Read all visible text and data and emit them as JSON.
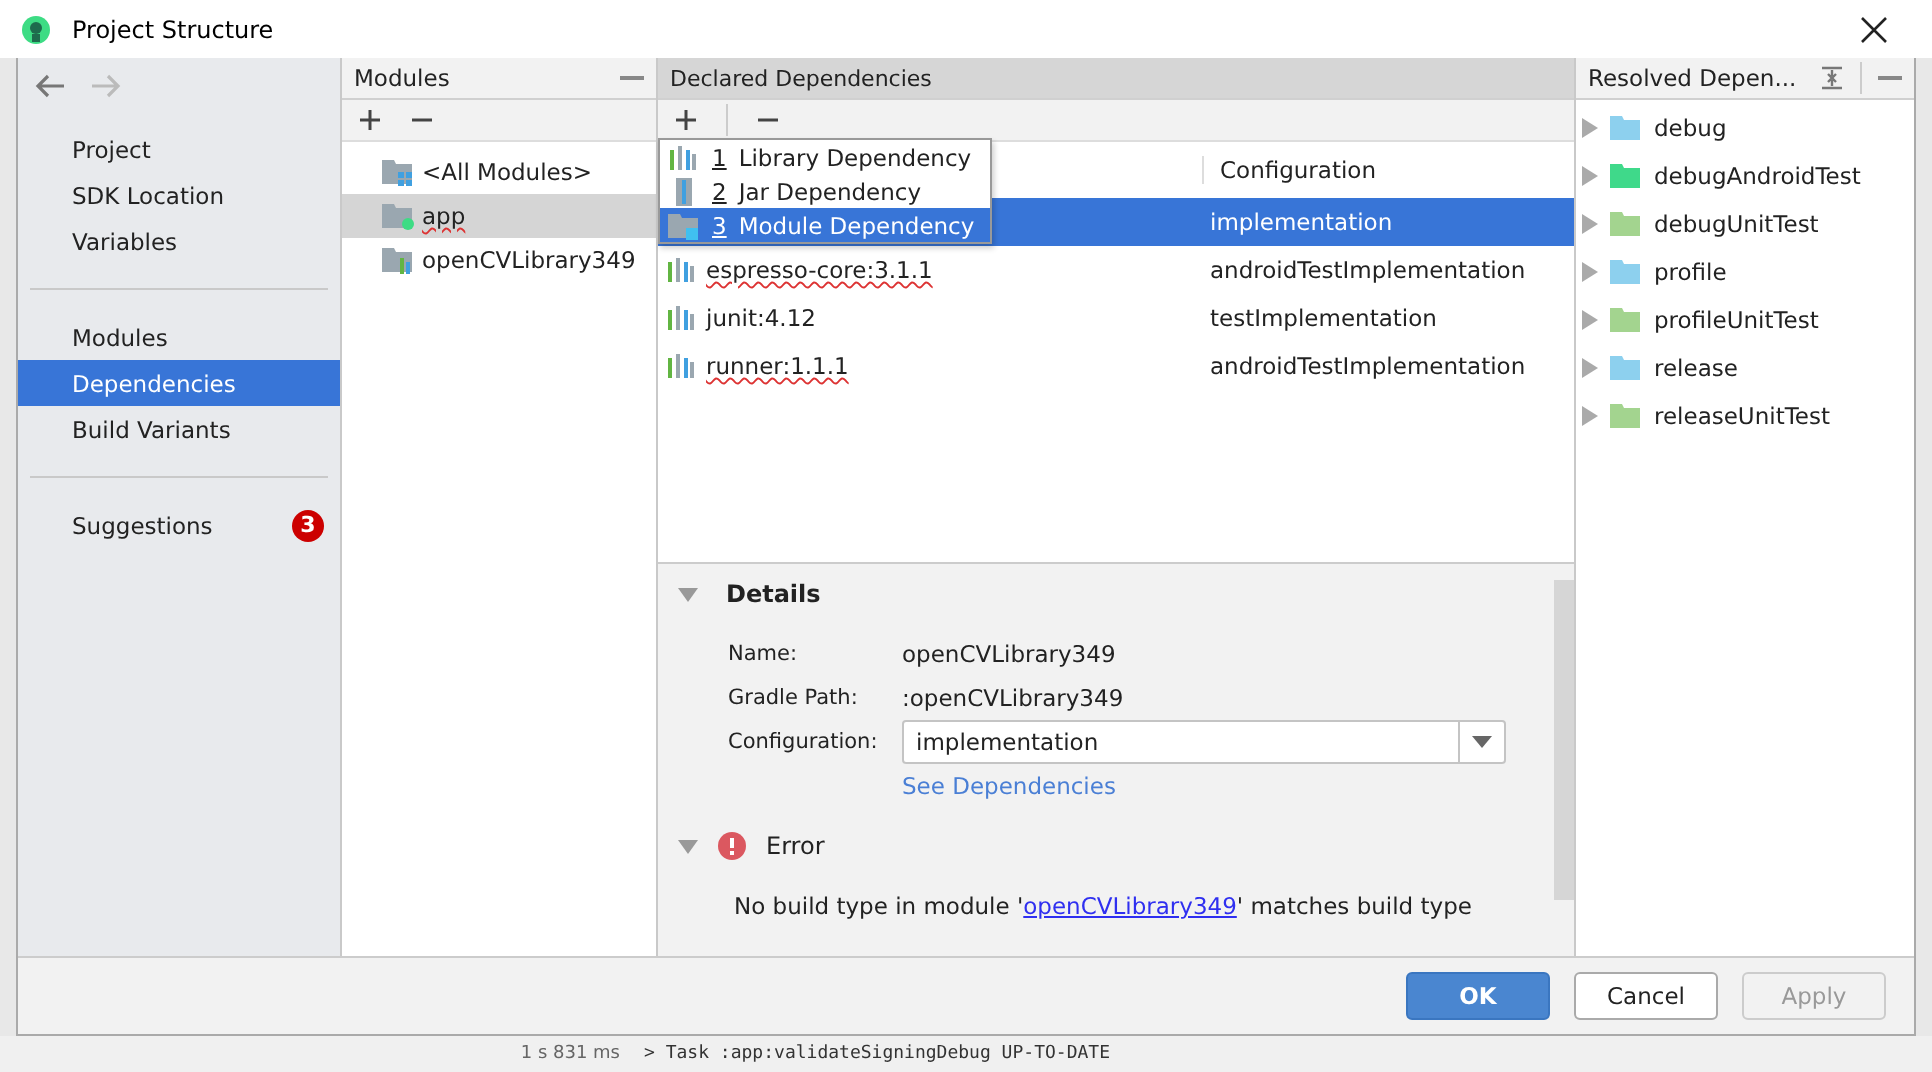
{
  "window": {
    "title": "Project Structure"
  },
  "sidebar": {
    "groups": [
      {
        "items": [
          {
            "label": "Project",
            "selected": false
          },
          {
            "label": "SDK Location",
            "selected": false
          },
          {
            "label": "Variables",
            "selected": false
          }
        ]
      },
      {
        "items": [
          {
            "label": "Modules",
            "selected": false
          },
          {
            "label": "Dependencies",
            "selected": true
          },
          {
            "label": "Build Variants",
            "selected": false
          }
        ]
      },
      {
        "items": [
          {
            "label": "Suggestions",
            "selected": false,
            "badge": "3"
          }
        ]
      }
    ]
  },
  "modules": {
    "title": "Modules",
    "items": [
      {
        "label": "<All Modules>",
        "kind": "all",
        "selected": false,
        "underlined": false
      },
      {
        "label": "app",
        "kind": "app",
        "selected": true,
        "underlined": true
      },
      {
        "label": "openCVLibrary349",
        "kind": "library",
        "selected": false,
        "underlined": false
      }
    ]
  },
  "declared": {
    "title": "Declared Dependencies",
    "columns": [
      "Configuration"
    ],
    "rows": [
      {
        "name": "",
        "configuration": "implementation",
        "selected": true
      },
      {
        "name": "espresso-core:3.1.1",
        "configuration": "androidTestImplementation",
        "selected": false,
        "underlined": true
      },
      {
        "name": "junit:4.12",
        "configuration": "testImplementation",
        "selected": false,
        "underlined": false
      },
      {
        "name": "runner:1.1.1",
        "configuration": "androidTestImplementation",
        "selected": false,
        "underlined": true
      }
    ],
    "add_menu": [
      {
        "number": "1",
        "label": "Library Dependency",
        "kind": "library",
        "selected": false
      },
      {
        "number": "2",
        "label": "Jar Dependency",
        "kind": "jar",
        "selected": false
      },
      {
        "number": "3",
        "label": "Module Dependency",
        "kind": "module",
        "selected": true
      }
    ]
  },
  "details": {
    "title": "Details",
    "name_label": "Name:",
    "name": "openCVLibrary349",
    "path_label": "Gradle Path:",
    "path": ":openCVLibrary349",
    "configuration_label": "Configuration:",
    "configuration": "implementation",
    "link": "See Dependencies",
    "error_title": "Error",
    "error_before": "No build type in module '",
    "error_link": "openCVLibrary349",
    "error_after": "' matches build type"
  },
  "resolved": {
    "title": "Resolved Depen...",
    "items": [
      {
        "label": "debug",
        "color": "#8dd0ee"
      },
      {
        "label": "debugAndroidTest",
        "color": "#3fd98a"
      },
      {
        "label": "debugUnitTest",
        "color": "#a3d48f"
      },
      {
        "label": "profile",
        "color": "#8dd0ee"
      },
      {
        "label": "profileUnitTest",
        "color": "#a3d48f"
      },
      {
        "label": "release",
        "color": "#8dd0ee"
      },
      {
        "label": "releaseUnitTest",
        "color": "#a3d48f"
      }
    ]
  },
  "buttons": [
    {
      "label": "OK",
      "kind": "primary",
      "disabled": false
    },
    {
      "label": "Cancel",
      "kind": "normal",
      "disabled": false
    },
    {
      "label": "Apply",
      "kind": "normal",
      "disabled": true
    }
  ],
  "background": {
    "timing": "1 s 831 ms",
    "console_line": "> Task :app:validateSigningDebug UP-TO-DATE"
  }
}
